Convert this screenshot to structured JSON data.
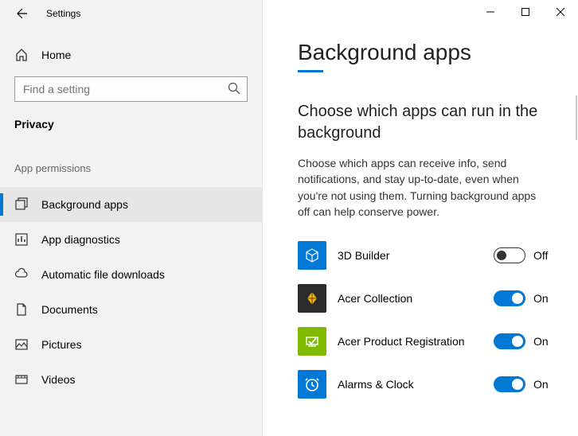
{
  "window": {
    "title": "Settings"
  },
  "sidebar": {
    "home_label": "Home",
    "search_placeholder": "Find a setting",
    "category": "Privacy",
    "section_label": "App permissions",
    "nav": [
      {
        "label": "Background apps",
        "selected": true
      },
      {
        "label": "App diagnostics",
        "selected": false
      },
      {
        "label": "Automatic file downloads",
        "selected": false
      },
      {
        "label": "Documents",
        "selected": false
      },
      {
        "label": "Pictures",
        "selected": false
      },
      {
        "label": "Videos",
        "selected": false
      }
    ]
  },
  "page": {
    "title": "Background apps",
    "subhead": "Choose which apps can run in the background",
    "description": "Choose which apps can receive info, send notifications, and stay up-to-date, even when you're not using them. Turning background apps off can help conserve power."
  },
  "apps": [
    {
      "name": "3D Builder",
      "state": "Off",
      "icon_bg": "#0078d4"
    },
    {
      "name": "Acer Collection",
      "state": "On",
      "icon_bg": "#2b2b2b"
    },
    {
      "name": "Acer Product Registration",
      "state": "On",
      "icon_bg": "#7fba00"
    },
    {
      "name": "Alarms & Clock",
      "state": "On",
      "icon_bg": "#0078d4"
    }
  ],
  "toggle_states": {
    "on_label": "On",
    "off_label": "Off"
  }
}
